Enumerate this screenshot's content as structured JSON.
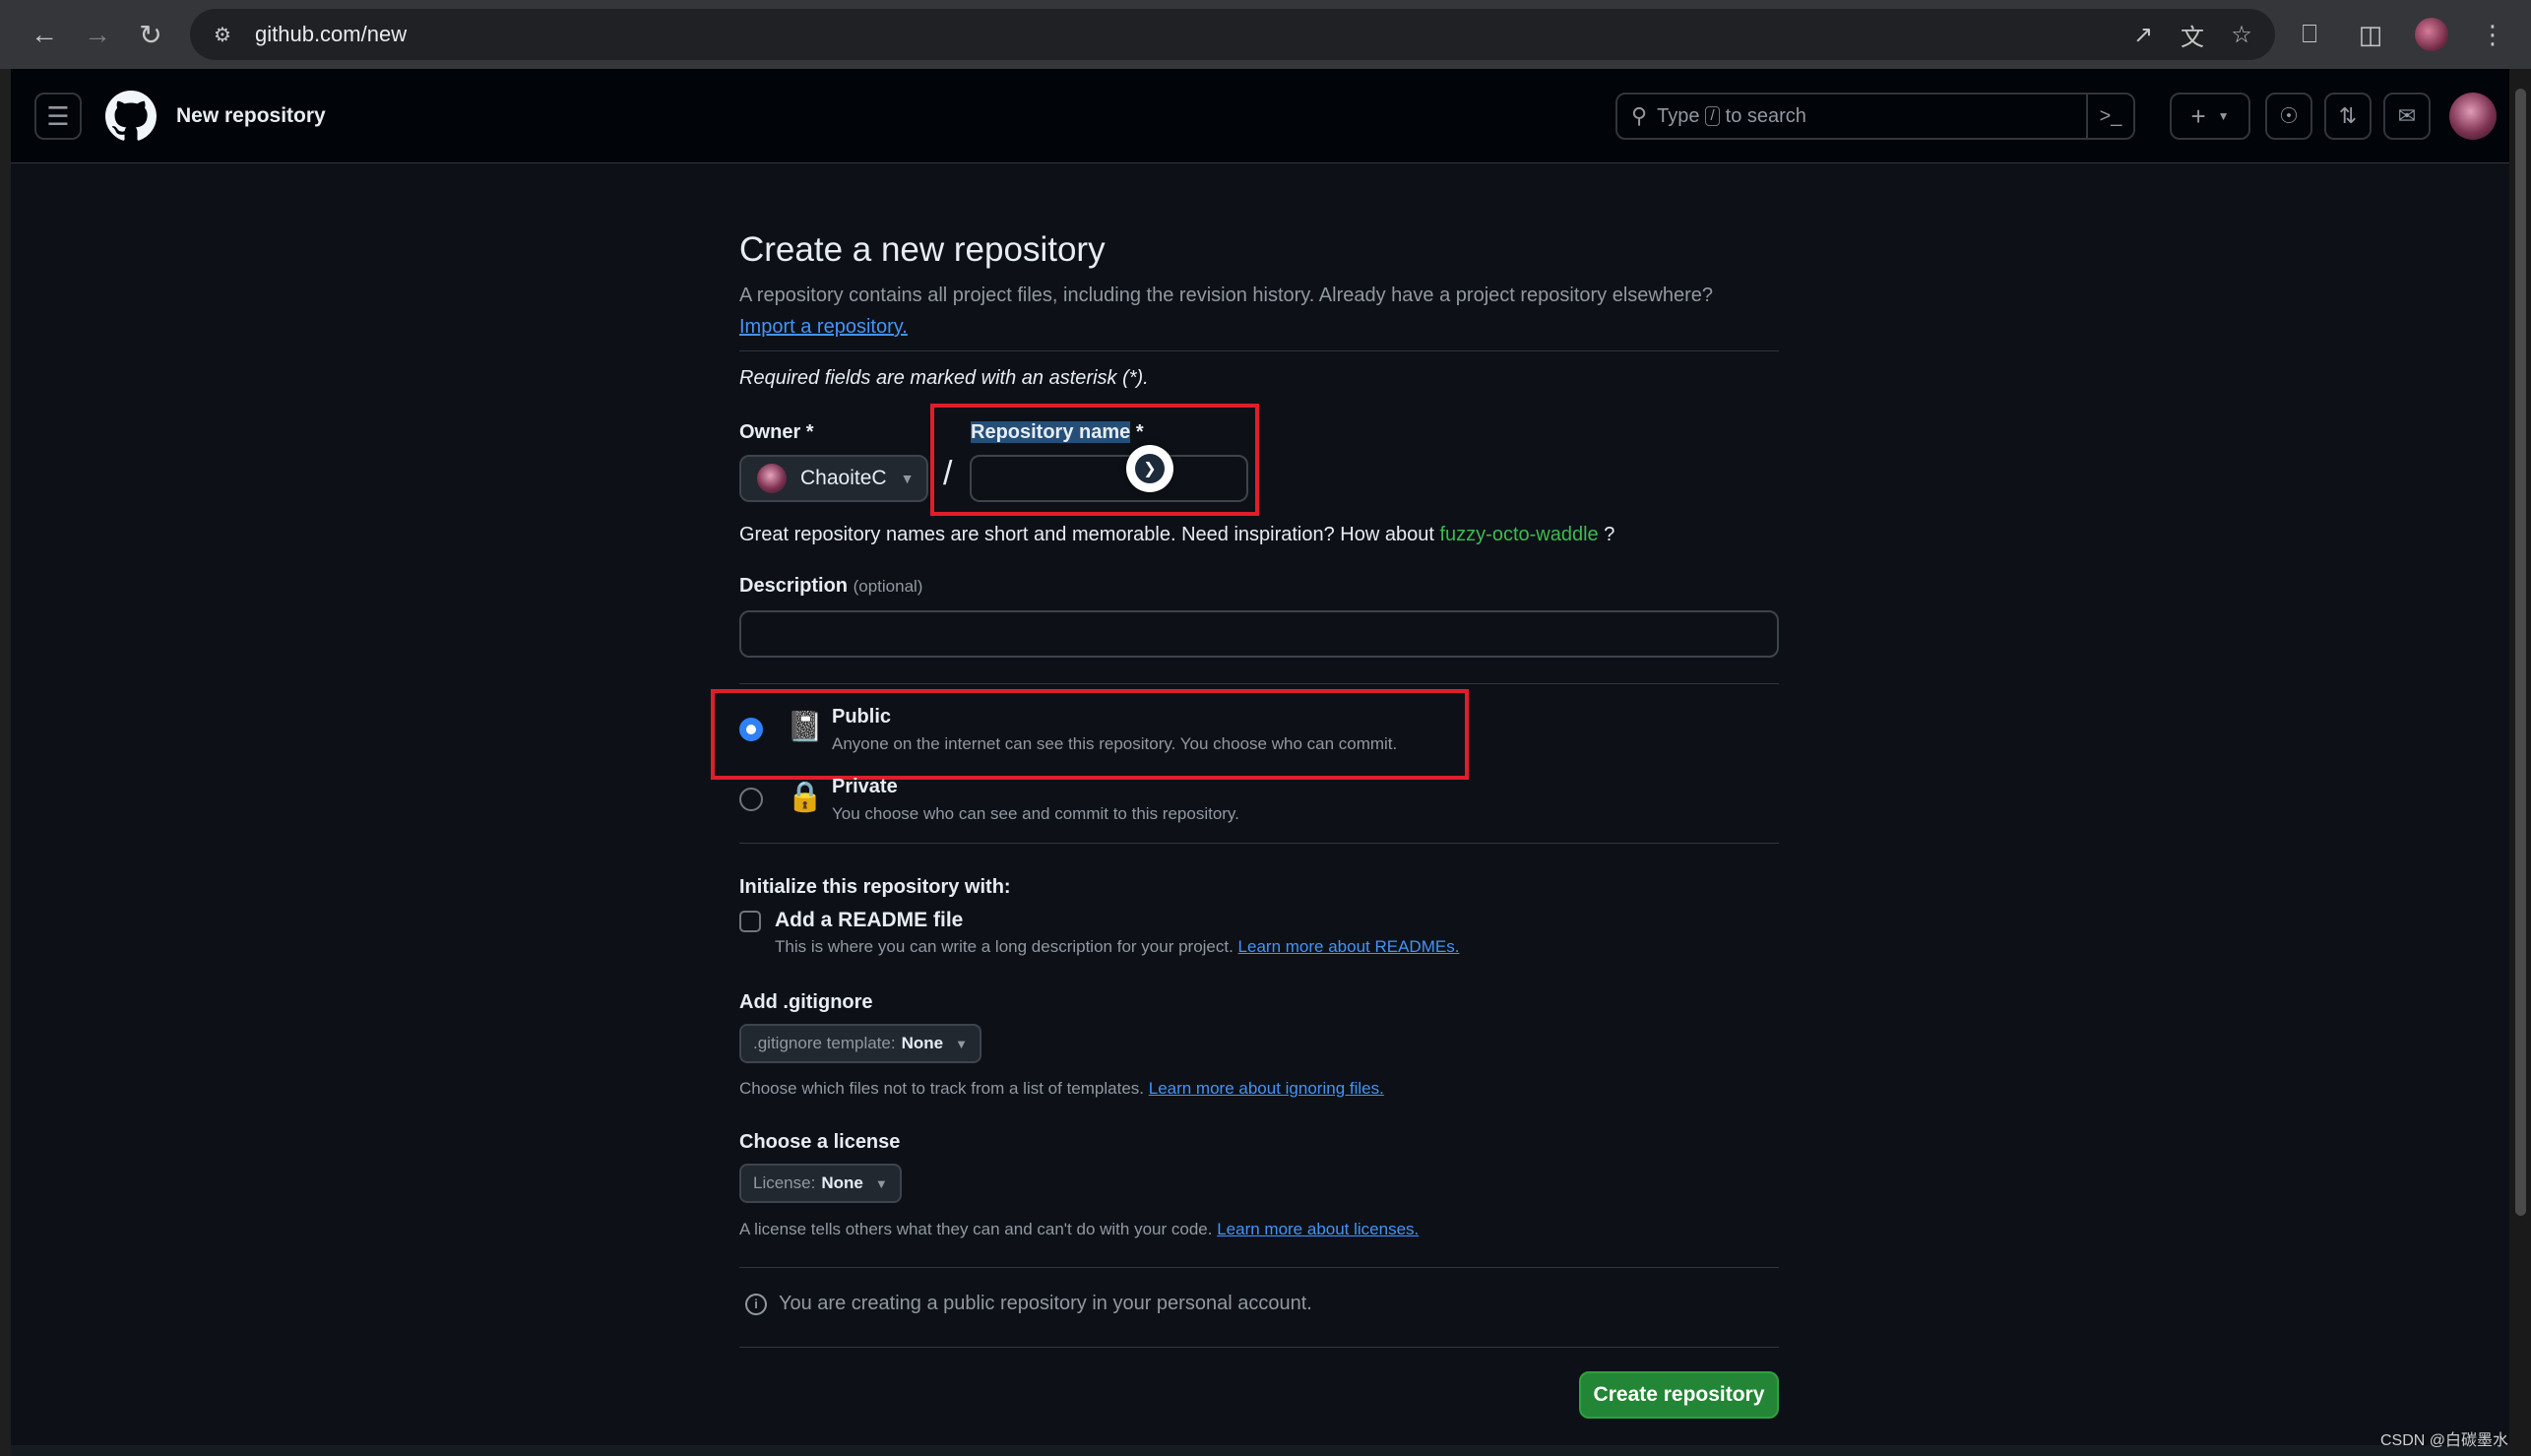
{
  "browser": {
    "url": "github.com/new",
    "icons": [
      "back-icon",
      "forward-icon",
      "reload-icon",
      "site-info-icon",
      "open-in-app-icon",
      "translate-icon",
      "bookmark-star-icon",
      "extensions-icon",
      "side-panel-icon",
      "profile-avatar",
      "menu-kebab-icon"
    ]
  },
  "header": {
    "title": "New repository",
    "search": {
      "prefix": "Type",
      "key": "/",
      "suffix": "to search"
    },
    "plus": "+",
    "icons": [
      "hamburger-icon",
      "github-logo",
      "search-icon",
      "command-palette-icon",
      "plus-icon",
      "issues-icon",
      "pull-requests-icon",
      "inbox-icon",
      "user-avatar"
    ]
  },
  "page": {
    "title": "Create a new repository",
    "subtitle": "A repository contains all project files, including the revision history. Already have a project repository elsewhere?",
    "import_link": "Import a repository.",
    "required_note": "Required fields are marked with an asterisk (*).",
    "owner_label": "Owner *",
    "owner_value": "ChaoiteC",
    "slash": "/",
    "repo_name_label": "Repository name",
    "repo_name_asterisk": " *",
    "repo_name_value": "",
    "suggest_prefix": "Great repository names are short and memorable. Need inspiration? How about ",
    "suggest_name": "fuzzy-octo-waddle",
    "suggest_suffix": " ?",
    "description_label": "Description",
    "description_optional": "(optional)",
    "visibility": [
      {
        "title": "Public",
        "desc": "Anyone on the internet can see this repository. You choose who can commit.",
        "checked": true
      },
      {
        "title": "Private",
        "desc": "You choose who can see and commit to this repository.",
        "checked": false
      }
    ],
    "init_label": "Initialize this repository with:",
    "readme_title": "Add a README file",
    "readme_desc": "This is where you can write a long description for your project. ",
    "readme_link": "Learn more about READMEs.",
    "gitignore_label": "Add .gitignore",
    "gitignore_select_prefix": ".gitignore template:",
    "gitignore_select_value": "None",
    "gitignore_note": "Choose which files not to track from a list of templates. ",
    "gitignore_link": "Learn more about ignoring files.",
    "license_label": "Choose a license",
    "license_select_prefix": "License:",
    "license_select_value": "None",
    "license_note": "A license tells others what they can and can't do with your code. ",
    "license_link": "Learn more about licenses.",
    "info_text": "You are creating a public repository in your personal account.",
    "create_button": "Create repository"
  },
  "watermark": "CSDN @白碳墨水",
  "colors": {
    "background": "#0d1117",
    "header": "#010409",
    "accent_link": "#4493f8",
    "create_button": "#238636",
    "highlight_box": "#e01e2b",
    "suggest_green": "#3fb950"
  }
}
